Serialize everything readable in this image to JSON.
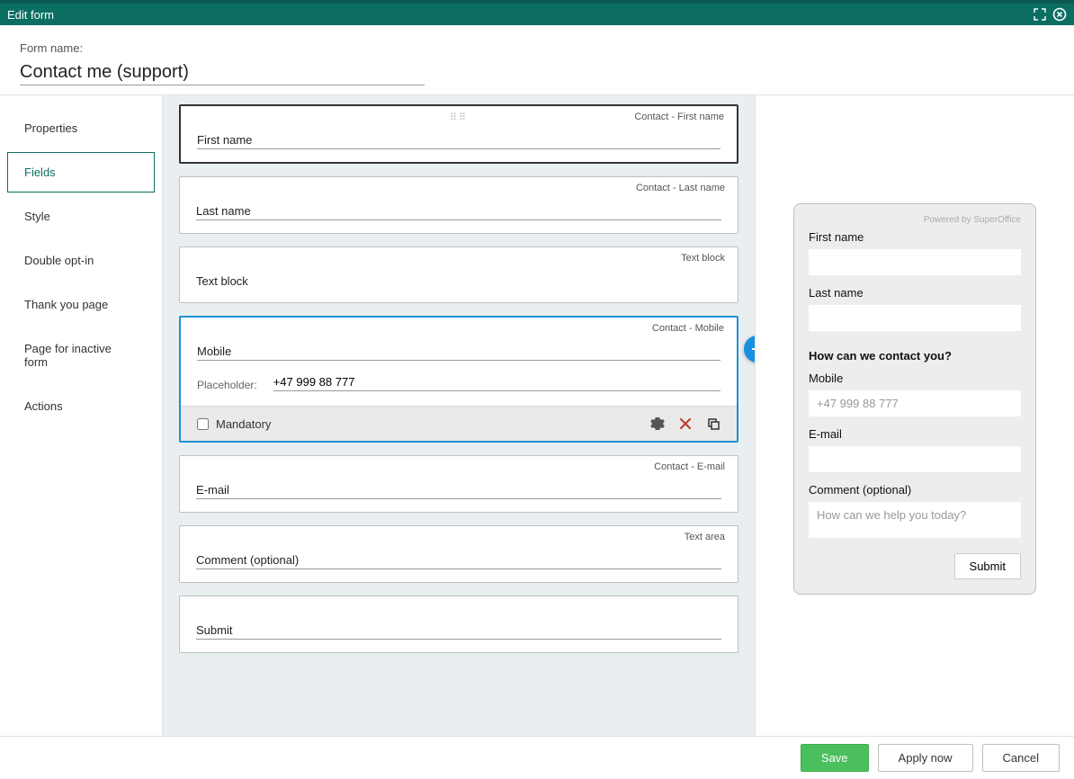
{
  "header": {
    "title": "Edit form"
  },
  "form_name": {
    "label": "Form name:",
    "value": "Contact me (support)"
  },
  "sidebar": {
    "items": [
      {
        "label": "Properties",
        "active": false
      },
      {
        "label": "Fields",
        "active": true
      },
      {
        "label": "Style",
        "active": false
      },
      {
        "label": "Double opt-in",
        "active": false
      },
      {
        "label": "Thank you page",
        "active": false
      },
      {
        "label": "Page for inactive form",
        "active": false
      },
      {
        "label": "Actions",
        "active": false
      }
    ]
  },
  "fields": [
    {
      "tag": "Contact - First name",
      "label": "First name",
      "highlight": "first"
    },
    {
      "tag": "Contact - Last name",
      "label": "Last name"
    },
    {
      "tag": "Text block",
      "label": "Text block"
    },
    {
      "tag": "Contact - Mobile",
      "label": "Mobile",
      "placeholder_label": "Placeholder:",
      "placeholder_value": "+47 999 88 777",
      "mandatory_label": "Mandatory",
      "highlight": "blue",
      "show_add": true
    },
    {
      "tag": "Contact - E-mail",
      "label": "E-mail"
    },
    {
      "tag": "Text area",
      "label": "Comment (optional)"
    },
    {
      "tag": "",
      "label": "Submit"
    }
  ],
  "preview": {
    "powered": "Powered by SuperOffice",
    "first_name_label": "First name",
    "last_name_label": "Last name",
    "heading": "How can we contact you?",
    "mobile_label": "Mobile",
    "mobile_placeholder": "+47 999 88 777",
    "email_label": "E-mail",
    "comment_label": "Comment (optional)",
    "comment_placeholder": "How can we help you today?",
    "submit": "Submit"
  },
  "footer": {
    "save": "Save",
    "apply": "Apply now",
    "cancel": "Cancel"
  }
}
